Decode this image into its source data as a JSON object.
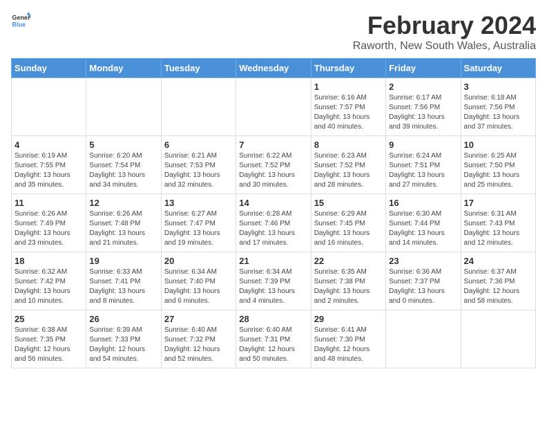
{
  "logo": {
    "text_general": "General",
    "text_blue": "Blue"
  },
  "title": "February 2024",
  "subtitle": "Raworth, New South Wales, Australia",
  "days_of_week": [
    "Sunday",
    "Monday",
    "Tuesday",
    "Wednesday",
    "Thursday",
    "Friday",
    "Saturday"
  ],
  "weeks": [
    [
      {
        "day": "",
        "info": ""
      },
      {
        "day": "",
        "info": ""
      },
      {
        "day": "",
        "info": ""
      },
      {
        "day": "",
        "info": ""
      },
      {
        "day": "1",
        "info": "Sunrise: 6:16 AM\nSunset: 7:57 PM\nDaylight: 13 hours and 40 minutes."
      },
      {
        "day": "2",
        "info": "Sunrise: 6:17 AM\nSunset: 7:56 PM\nDaylight: 13 hours and 39 minutes."
      },
      {
        "day": "3",
        "info": "Sunrise: 6:18 AM\nSunset: 7:56 PM\nDaylight: 13 hours and 37 minutes."
      }
    ],
    [
      {
        "day": "4",
        "info": "Sunrise: 6:19 AM\nSunset: 7:55 PM\nDaylight: 13 hours and 35 minutes."
      },
      {
        "day": "5",
        "info": "Sunrise: 6:20 AM\nSunset: 7:54 PM\nDaylight: 13 hours and 34 minutes."
      },
      {
        "day": "6",
        "info": "Sunrise: 6:21 AM\nSunset: 7:53 PM\nDaylight: 13 hours and 32 minutes."
      },
      {
        "day": "7",
        "info": "Sunrise: 6:22 AM\nSunset: 7:52 PM\nDaylight: 13 hours and 30 minutes."
      },
      {
        "day": "8",
        "info": "Sunrise: 6:23 AM\nSunset: 7:52 PM\nDaylight: 13 hours and 28 minutes."
      },
      {
        "day": "9",
        "info": "Sunrise: 6:24 AM\nSunset: 7:51 PM\nDaylight: 13 hours and 27 minutes."
      },
      {
        "day": "10",
        "info": "Sunrise: 6:25 AM\nSunset: 7:50 PM\nDaylight: 13 hours and 25 minutes."
      }
    ],
    [
      {
        "day": "11",
        "info": "Sunrise: 6:26 AM\nSunset: 7:49 PM\nDaylight: 13 hours and 23 minutes."
      },
      {
        "day": "12",
        "info": "Sunrise: 6:26 AM\nSunset: 7:48 PM\nDaylight: 13 hours and 21 minutes."
      },
      {
        "day": "13",
        "info": "Sunrise: 6:27 AM\nSunset: 7:47 PM\nDaylight: 13 hours and 19 minutes."
      },
      {
        "day": "14",
        "info": "Sunrise: 6:28 AM\nSunset: 7:46 PM\nDaylight: 13 hours and 17 minutes."
      },
      {
        "day": "15",
        "info": "Sunrise: 6:29 AM\nSunset: 7:45 PM\nDaylight: 13 hours and 16 minutes."
      },
      {
        "day": "16",
        "info": "Sunrise: 6:30 AM\nSunset: 7:44 PM\nDaylight: 13 hours and 14 minutes."
      },
      {
        "day": "17",
        "info": "Sunrise: 6:31 AM\nSunset: 7:43 PM\nDaylight: 13 hours and 12 minutes."
      }
    ],
    [
      {
        "day": "18",
        "info": "Sunrise: 6:32 AM\nSunset: 7:42 PM\nDaylight: 13 hours and 10 minutes."
      },
      {
        "day": "19",
        "info": "Sunrise: 6:33 AM\nSunset: 7:41 PM\nDaylight: 13 hours and 8 minutes."
      },
      {
        "day": "20",
        "info": "Sunrise: 6:34 AM\nSunset: 7:40 PM\nDaylight: 13 hours and 6 minutes."
      },
      {
        "day": "21",
        "info": "Sunrise: 6:34 AM\nSunset: 7:39 PM\nDaylight: 13 hours and 4 minutes."
      },
      {
        "day": "22",
        "info": "Sunrise: 6:35 AM\nSunset: 7:38 PM\nDaylight: 13 hours and 2 minutes."
      },
      {
        "day": "23",
        "info": "Sunrise: 6:36 AM\nSunset: 7:37 PM\nDaylight: 13 hours and 0 minutes."
      },
      {
        "day": "24",
        "info": "Sunrise: 6:37 AM\nSunset: 7:36 PM\nDaylight: 12 hours and 58 minutes."
      }
    ],
    [
      {
        "day": "25",
        "info": "Sunrise: 6:38 AM\nSunset: 7:35 PM\nDaylight: 12 hours and 56 minutes."
      },
      {
        "day": "26",
        "info": "Sunrise: 6:39 AM\nSunset: 7:33 PM\nDaylight: 12 hours and 54 minutes."
      },
      {
        "day": "27",
        "info": "Sunrise: 6:40 AM\nSunset: 7:32 PM\nDaylight: 12 hours and 52 minutes."
      },
      {
        "day": "28",
        "info": "Sunrise: 6:40 AM\nSunset: 7:31 PM\nDaylight: 12 hours and 50 minutes."
      },
      {
        "day": "29",
        "info": "Sunrise: 6:41 AM\nSunset: 7:30 PM\nDaylight: 12 hours and 48 minutes."
      },
      {
        "day": "",
        "info": ""
      },
      {
        "day": "",
        "info": ""
      }
    ]
  ]
}
